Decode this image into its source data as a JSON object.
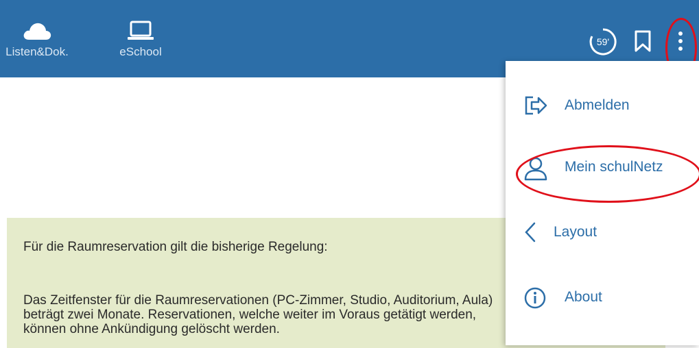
{
  "nav": {
    "items": [
      {
        "label": "Listen&Dok.",
        "icon": "cloud-icon"
      },
      {
        "label": "eSchool",
        "icon": "laptop-icon"
      }
    ]
  },
  "header": {
    "timer": "59'",
    "bookmark_icon": "bookmark-icon",
    "menu_icon": "kebab-menu-icon"
  },
  "menu": {
    "items": [
      {
        "label": "Abmelden",
        "icon": "logout-icon"
      },
      {
        "label": "Mein schulNetz",
        "icon": "user-icon"
      },
      {
        "label": "Layout",
        "icon": "chevron-left-icon"
      },
      {
        "label": "About",
        "icon": "info-icon"
      }
    ]
  },
  "notice": {
    "line1": "Für die Raumreservation gilt die bisherige Regelung:",
    "body": "Das Zeitfenster für die Raumreservationen (PC-Zimmer, Studio, Auditorium, Aula) beträgt zwei Monate. Reservationen, welche weiter im Voraus getätigt werden, können ohne Ankündigung gelöscht werden."
  },
  "colors": {
    "topbar": "#2c6ea8",
    "accent": "#2c6ea8",
    "notice_bg": "#e5ebcb",
    "highlight": "#e0101a"
  }
}
